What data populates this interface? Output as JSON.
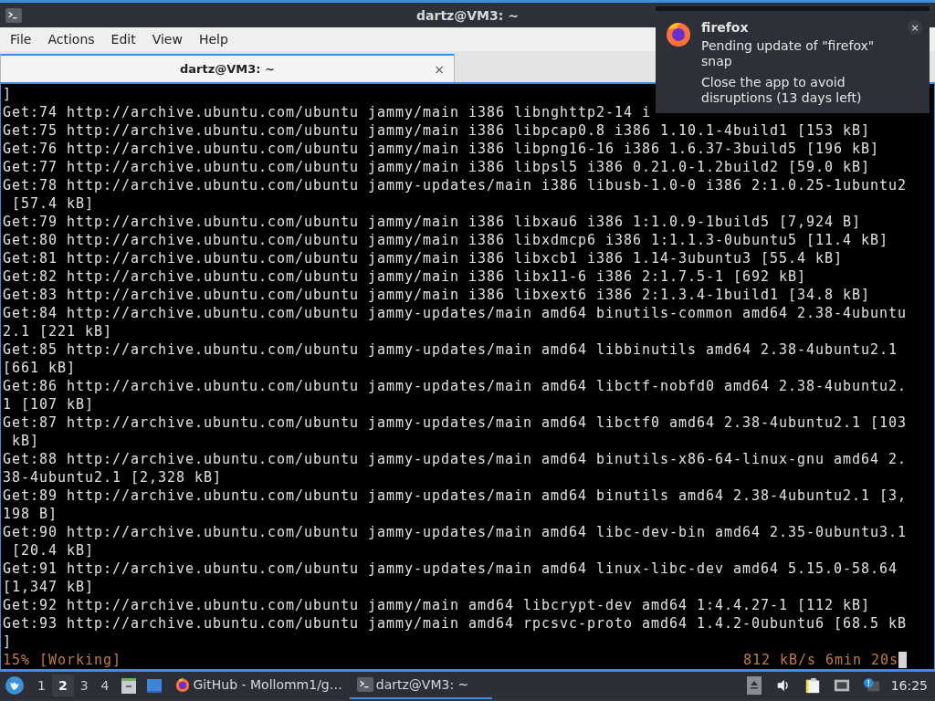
{
  "window": {
    "title": "dartz@VM3: ~"
  },
  "menu": [
    "File",
    "Actions",
    "Edit",
    "View",
    "Help"
  ],
  "tabs": [
    {
      "label": "dartz@VM3: ~",
      "close": "×",
      "selected": true
    }
  ],
  "terminal": {
    "lines": [
      "]",
      "Get:74 http://archive.ubuntu.com/ubuntu jammy/main i386 libnghttp2-14 i",
      "Get:75 http://archive.ubuntu.com/ubuntu jammy/main i386 libpcap0.8 i386 1.10.1-4build1 [153 kB]",
      "Get:76 http://archive.ubuntu.com/ubuntu jammy/main i386 libpng16-16 i386 1.6.37-3build5 [196 kB]",
      "Get:77 http://archive.ubuntu.com/ubuntu jammy/main i386 libpsl5 i386 0.21.0-1.2build2 [59.0 kB]",
      "Get:78 http://archive.ubuntu.com/ubuntu jammy-updates/main i386 libusb-1.0-0 i386 2:1.0.25-1ubuntu2",
      " [57.4 kB]",
      "Get:79 http://archive.ubuntu.com/ubuntu jammy/main i386 libxau6 i386 1:1.0.9-1build5 [7,924 B]",
      "Get:80 http://archive.ubuntu.com/ubuntu jammy/main i386 libxdmcp6 i386 1:1.1.3-0ubuntu5 [11.4 kB]",
      "Get:81 http://archive.ubuntu.com/ubuntu jammy/main i386 libxcb1 i386 1.14-3ubuntu3 [55.4 kB]",
      "Get:82 http://archive.ubuntu.com/ubuntu jammy/main i386 libx11-6 i386 2:1.7.5-1 [692 kB]",
      "Get:83 http://archive.ubuntu.com/ubuntu jammy/main i386 libxext6 i386 2:1.3.4-1build1 [34.8 kB]",
      "Get:84 http://archive.ubuntu.com/ubuntu jammy-updates/main amd64 binutils-common amd64 2.38-4ubuntu",
      "2.1 [221 kB]",
      "Get:85 http://archive.ubuntu.com/ubuntu jammy-updates/main amd64 libbinutils amd64 2.38-4ubuntu2.1",
      "[661 kB]",
      "Get:86 http://archive.ubuntu.com/ubuntu jammy-updates/main amd64 libctf-nobfd0 amd64 2.38-4ubuntu2.",
      "1 [107 kB]",
      "Get:87 http://archive.ubuntu.com/ubuntu jammy-updates/main amd64 libctf0 amd64 2.38-4ubuntu2.1 [103",
      " kB]",
      "Get:88 http://archive.ubuntu.com/ubuntu jammy-updates/main amd64 binutils-x86-64-linux-gnu amd64 2.",
      "38-4ubuntu2.1 [2,328 kB]",
      "Get:89 http://archive.ubuntu.com/ubuntu jammy-updates/main amd64 binutils amd64 2.38-4ubuntu2.1 [3,",
      "198 B]",
      "Get:90 http://archive.ubuntu.com/ubuntu jammy-updates/main amd64 libc-dev-bin amd64 2.35-0ubuntu3.1",
      " [20.4 kB]",
      "Get:91 http://archive.ubuntu.com/ubuntu jammy-updates/main amd64 linux-libc-dev amd64 5.15.0-58.64",
      "[1,347 kB]",
      "Get:92 http://archive.ubuntu.com/ubuntu jammy/main amd64 libcrypt-dev amd64 1:4.4.27-1 [112 kB]",
      "Get:93 http://archive.ubuntu.com/ubuntu jammy/main amd64 rpcsvc-proto amd64 1.4.2-0ubuntu6 [68.5 kB",
      "]"
    ],
    "status_left": "15% [Working]",
    "status_right": "812 kB/s 6min 20s"
  },
  "notification": {
    "app": "firefox",
    "close": "×",
    "body": "Pending update of \"firefox\" snap",
    "detail": "Close the app to avoid disruptions (13 days left)"
  },
  "taskbar": {
    "workspaces": [
      {
        "label": "1",
        "selected": false
      },
      {
        "label": "2",
        "selected": true
      },
      {
        "label": "3",
        "selected": false
      },
      {
        "label": "4",
        "selected": false
      }
    ],
    "tasks": [
      {
        "kind": "browser",
        "label": "GitHub - Mollomm1/g…",
        "active": false
      },
      {
        "kind": "terminal",
        "label": "dartz@VM3: ~",
        "active": true
      }
    ],
    "clock": "16:25"
  }
}
